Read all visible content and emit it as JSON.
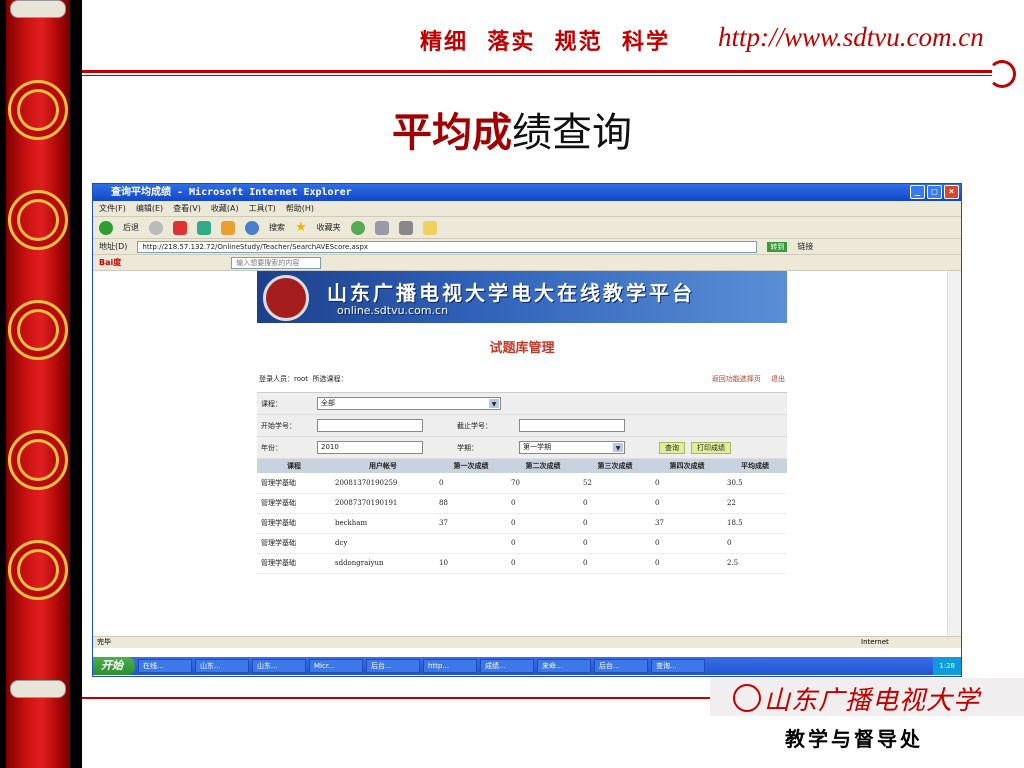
{
  "header": {
    "slogan": "精细  落实  规范  科学",
    "url": "http://www.sdtvu.com.cn"
  },
  "slide_title": {
    "strong": "平均成",
    "rest": "绩查询"
  },
  "browser": {
    "window_title": "查询平均成绩 - Microsoft Internet Explorer",
    "menu": [
      "文件(F)",
      "编辑(E)",
      "查看(V)",
      "收藏(A)",
      "工具(T)",
      "帮助(H)"
    ],
    "toolbar": {
      "back": "后退",
      "search": "搜索",
      "favorites": "收藏夹"
    },
    "address_label": "地址(D)",
    "address": "http://218.57.132.72/OnlineStudy/Teacher/SearchAVEScore.aspx",
    "go": "转到",
    "links": "链接",
    "baidu_placeholder": "输入想要搜索的内容",
    "status": "完毕",
    "zone": "Internet"
  },
  "page": {
    "banner_title": "山东广播电视大学电大在线教学平台",
    "banner_sub": "online.sdtvu.com.cn",
    "title": "试题库管理",
    "login_info": "登录人员：root  所选课程：",
    "link_back": "返回功能选择页",
    "link_logout": "退出",
    "form": {
      "course_label": "课程：",
      "course_value": "全部",
      "start_label": "开始学号：",
      "end_label": "截止学号：",
      "year_label": "年份：",
      "year_value": "2010",
      "term_label": "学期：",
      "term_value": "第一学期",
      "query_btn": "查询",
      "print_btn": "打印成绩"
    },
    "table": {
      "headers": [
        "课程",
        "用户帐号",
        "第一次成绩",
        "第二次成绩",
        "第三次成绩",
        "第四次成绩",
        "平均成绩"
      ],
      "rows": [
        [
          "管理学基础",
          "20081370190259",
          "0",
          "70",
          "52",
          "0",
          "30.5"
        ],
        [
          "管理学基础",
          "20087370190191",
          "88",
          "0",
          "0",
          "0",
          "22"
        ],
        [
          "管理学基础",
          "beckham",
          "37",
          "0",
          "0",
          "37",
          "18.5"
        ],
        [
          "管理学基础",
          "dcy",
          "",
          "0",
          "0",
          "0",
          "0"
        ],
        [
          "管理学基础",
          "sddongraiyun",
          "10",
          "0",
          "0",
          "0",
          "2.5"
        ]
      ]
    }
  },
  "taskbar": {
    "start": "开始",
    "tasks": [
      "在线...",
      "山东...",
      "山东...",
      "Micr...",
      "后台...",
      "http...",
      "成绩...",
      "来命...",
      "后台...",
      "查询..."
    ],
    "clock": "1:28"
  },
  "footer": {
    "brand": "山东广播电视大学",
    "dept": "教学与督导处"
  }
}
